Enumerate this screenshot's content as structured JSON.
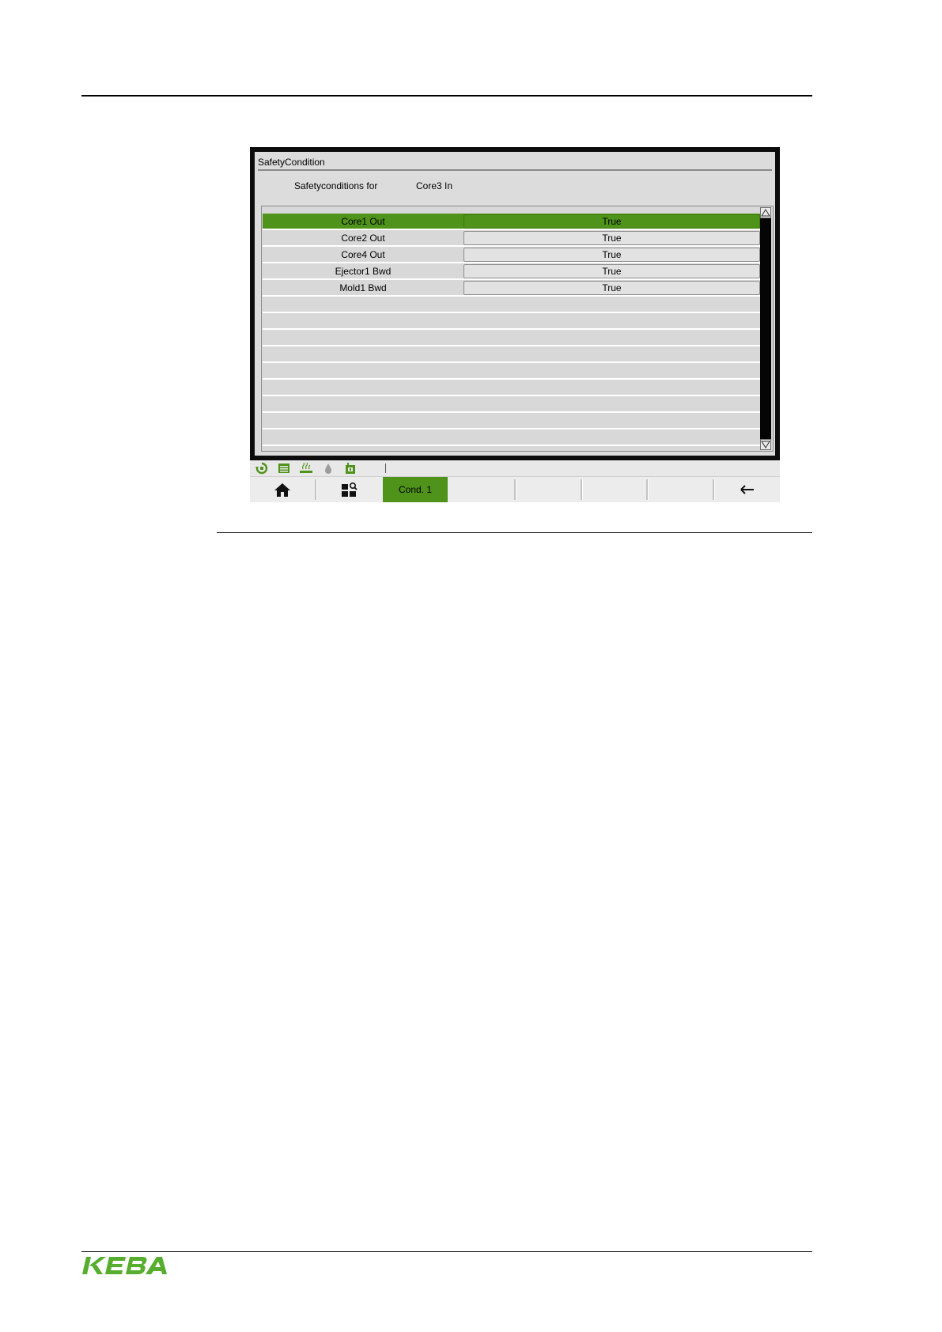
{
  "window": {
    "title": "SafetyCondition",
    "header_label": "Safetyconditions for",
    "header_value": "Core3 In"
  },
  "conditions": [
    {
      "name": "Core1 Out",
      "value": "True"
    },
    {
      "name": "Core2 Out",
      "value": "True"
    },
    {
      "name": "Core4 Out",
      "value": "True"
    },
    {
      "name": "Ejector1 Bwd",
      "value": "True"
    },
    {
      "name": "Mold1 Bwd",
      "value": "True"
    }
  ],
  "status_icons": [
    "cycle-icon",
    "list-icon",
    "heater-icon",
    "drop-icon",
    "robot-icon"
  ],
  "softkeys": {
    "home_icon": "home-icon",
    "overview_icon": "overview-icon",
    "cond1_label": "Cond. 1",
    "back_icon": "back-arrow-icon"
  },
  "colors": {
    "accent_green": "#4f931a",
    "frame_black": "#0c0c0c",
    "panel_gray": "#dcdcdc"
  },
  "logo": {
    "text": "KEBA"
  }
}
